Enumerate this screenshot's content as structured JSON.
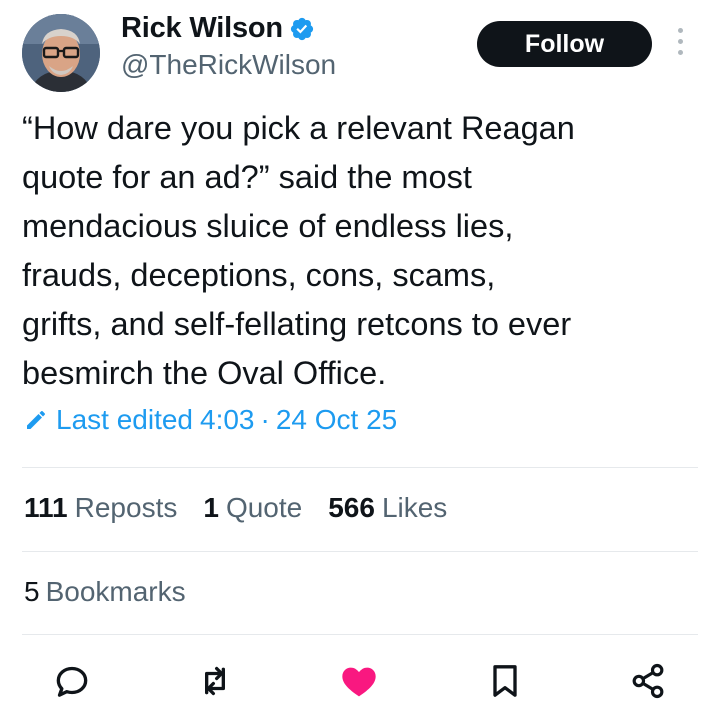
{
  "author": {
    "name": "Rick Wilson",
    "handle": "@TheRickWilson",
    "verified": true
  },
  "follow_label": "Follow",
  "tweet": {
    "text": "“How dare you pick a relevant Reagan\nquote for an ad?” said the most\nmendacious sluice of endless lies,\nfrauds, deceptions, cons, scams,\ngrifts, and self-fellating retcons to ever\nbesmirch the Oval Office."
  },
  "edited": {
    "label": "Last edited",
    "time": "4:03",
    "separator": "·",
    "date": "24 Oct 25"
  },
  "stats": [
    {
      "count": "111",
      "label": "Reposts"
    },
    {
      "count": "1",
      "label": "Quote"
    },
    {
      "count": "566",
      "label": "Likes"
    }
  ],
  "bookmarks": {
    "count": "5",
    "label": "Bookmarks"
  },
  "actions": [
    {
      "icon": "reply-icon"
    },
    {
      "icon": "repost-icon"
    },
    {
      "icon": "like-icon",
      "active": true
    },
    {
      "icon": "bookmark-icon"
    },
    {
      "icon": "share-icon"
    }
  ],
  "colors": {
    "accent": "#1d9bf0",
    "text": "#0f1419",
    "secondary": "#536471",
    "like_active": "#f91880",
    "follow_bg": "#0f1419"
  }
}
